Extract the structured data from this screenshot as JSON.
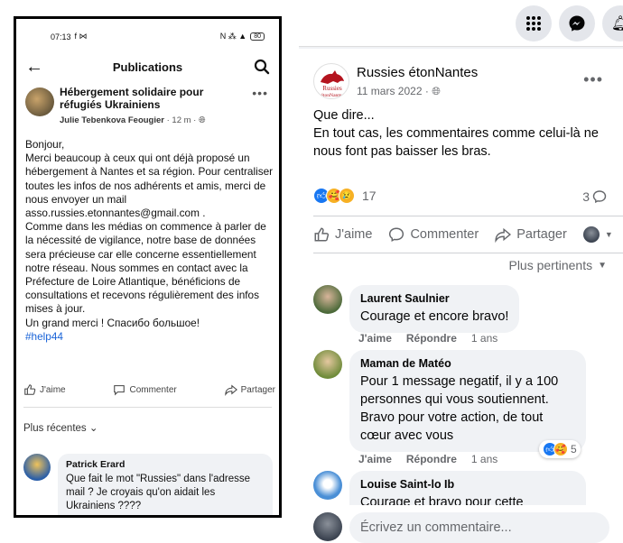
{
  "phone": {
    "status": {
      "time": "07:13",
      "left_icons": "f ⋈",
      "right_icons": "N ⁂ ▲",
      "battery": "80"
    },
    "header": {
      "title": "Publications"
    },
    "post": {
      "group_name": "Hébergement solidaire pour réfugiés Ukrainiens",
      "author": "Julie Tebenkova Feougier",
      "time": "12 m",
      "more": "•••",
      "body_lines": [
        "Bonjour,",
        "Merci beaucoup à ceux qui ont déjà proposé un hébergement à Nantes et sa région. Pour centraliser toutes les infos de nos adhérents et amis, merci de nous envoyer un mail asso.russies.etonnantes@gmail.com .",
        "Comme dans les médias on commence à parler de la nécessité de vigilance, notre base de données sera précieuse car elle concerne essentiellement notre réseau. Nous sommes en contact avec la Préfecture de Loire Atlantique, bénéficions de consultations et recevons régulièrement des infos mises à jour.",
        "Un grand merci ! Спасибо большое!"
      ],
      "hashtag": "#help44",
      "actions": {
        "like": "J'aime",
        "comment": "Commenter",
        "share": "Partager"
      }
    },
    "recents_label": "Plus récentes",
    "comment": {
      "name": "Patrick Erard",
      "text": "Que fait le mot \"Russies\" dans l'adresse mail ? Je croyais qu'on aidait les Ukrainiens ????"
    }
  },
  "fb": {
    "post": {
      "page_name": "Russies étonNantes",
      "logo_text_top": "Russies",
      "logo_text_bottom": "étonNantes",
      "date": "11 mars 2022",
      "date_sep": "·",
      "more": "•••",
      "text": "Que dire...\nEn tout cas, les commentaires comme celui-là ne nous font pas baisser les bras.",
      "reaction_count": "17",
      "comment_count": "3",
      "actions": {
        "like": "J'aime",
        "comment": "Commenter",
        "share": "Partager"
      },
      "sort_label": "Plus pertinents"
    },
    "comments": [
      {
        "name": "Laurent Saulnier",
        "text": "Courage et encore bravo!",
        "like": "J'aime",
        "reply": "Répondre",
        "time": "1 ans"
      },
      {
        "name": "Maman de Matéo",
        "text": "Pour 1 message negatif, il y a 100 personnes qui vous soutiennent. Bravo pour votre action, de tout cœur avec vous",
        "like": "J'aime",
        "reply": "Répondre",
        "time": "1 ans",
        "reaction_count": "5"
      },
      {
        "name": "Louise Saint-lo Ib",
        "text": "Courage et bravo pour cette"
      }
    ],
    "write_placeholder": "Écrivez un commentaire...",
    "colors": {
      "accent": "#1877f2",
      "bubble": "#f0f2f5",
      "muted": "#65676b",
      "hashtag": "#1a64d8"
    }
  }
}
